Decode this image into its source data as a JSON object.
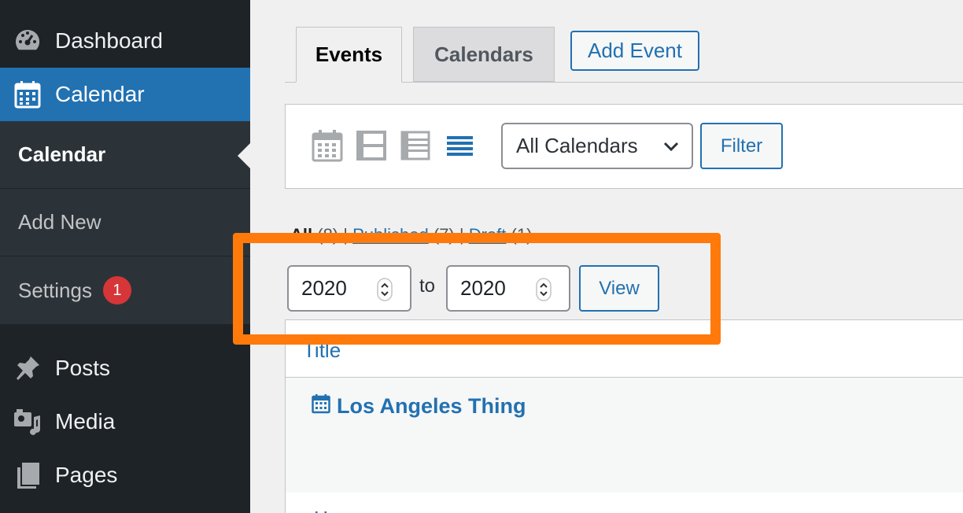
{
  "sidebar": {
    "dashboard": "Dashboard",
    "calendar": "Calendar",
    "submenu": {
      "current": "Calendar",
      "add_new": "Add New",
      "settings": "Settings",
      "settings_badge": "1"
    },
    "posts": "Posts",
    "media": "Media",
    "pages": "Pages"
  },
  "tabs": {
    "events": "Events",
    "calendars": "Calendars",
    "add_event": "Add Event"
  },
  "toolbar": {
    "view_icons": [
      "month-view-icon",
      "week-view-icon",
      "list-view-icon",
      "compact-list-icon"
    ],
    "calendar_select": "All Calendars",
    "filter_label": "Filter"
  },
  "status": {
    "all": "All",
    "all_count": "(8)",
    "published": "Published",
    "published_count": "(7)",
    "draft": "Draft",
    "draft_count": "(1)",
    "sep": "|"
  },
  "range": {
    "from": "2020",
    "to_label": "to",
    "to": "2020",
    "view_label": "View"
  },
  "table": {
    "column_title": "Title",
    "rows": [
      {
        "title": "Los Angeles Thing"
      }
    ]
  },
  "colors": {
    "sidebar_bg": "#1d2327",
    "sidebar_active": "#2271b1",
    "accent": "#2271b1",
    "highlight": "#ff7a0a",
    "badge": "#d63638"
  }
}
